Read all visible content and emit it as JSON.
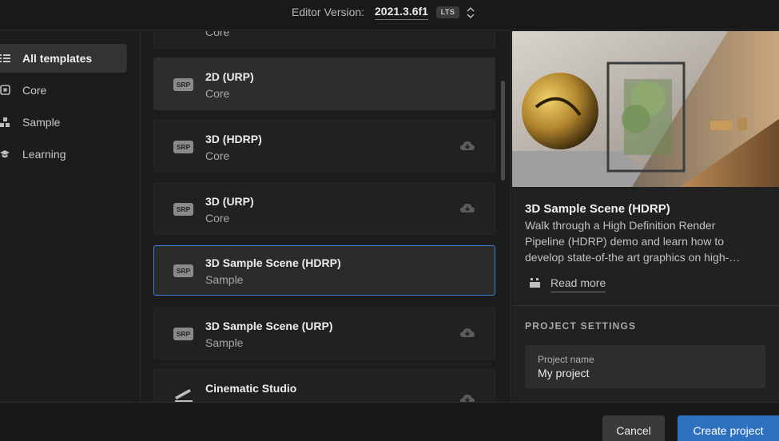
{
  "header": {
    "editor_version_label": "Editor Version:",
    "editor_version": "2021.3.6f1",
    "lts_badge": "LTS"
  },
  "sidebar": {
    "items": [
      {
        "label": "All templates",
        "icon": "list-icon",
        "active": true
      },
      {
        "label": "Core",
        "icon": "core-icon",
        "active": false
      },
      {
        "label": "Sample",
        "icon": "sample-icon",
        "active": false
      },
      {
        "label": "Learning",
        "icon": "graduation-cap-icon",
        "active": false
      }
    ]
  },
  "templates": [
    {
      "title": "",
      "subtitle": "Core"
    },
    {
      "title": "2D (URP)",
      "subtitle": "Core",
      "badge": "SRP",
      "state": "downloaded"
    },
    {
      "title": "3D (HDRP)",
      "subtitle": "Core",
      "badge": "SRP",
      "state": "download-available"
    },
    {
      "title": "3D (URP)",
      "subtitle": "Core",
      "badge": "SRP",
      "state": "download-available"
    },
    {
      "title": "3D Sample Scene (HDRP)",
      "subtitle": "Sample",
      "badge": "SRP",
      "state": "selected"
    },
    {
      "title": "3D Sample Scene (URP)",
      "subtitle": "Sample",
      "badge": "SRP",
      "state": "download-available"
    },
    {
      "title": "Cinematic Studio",
      "subtitle": "",
      "icon": "cinematic-icon",
      "state": "download-available"
    }
  ],
  "detail": {
    "title": "3D Sample Scene (HDRP)",
    "description": "Walk through a High Definition Render\nPipeline (HDRP) demo and learn how to\ndevelop state-of-the art graphics on high-…",
    "read_more": "Read more",
    "project_settings_title": "PROJECT SETTINGS",
    "project_name_label": "Project name",
    "project_name_value": "My project"
  },
  "footer": {
    "cancel_label": "Cancel",
    "create_label": "Create project"
  },
  "colors": {
    "accent": "#2f71c1",
    "selection_border": "#3d83d4",
    "background": "#1c1c1c"
  }
}
